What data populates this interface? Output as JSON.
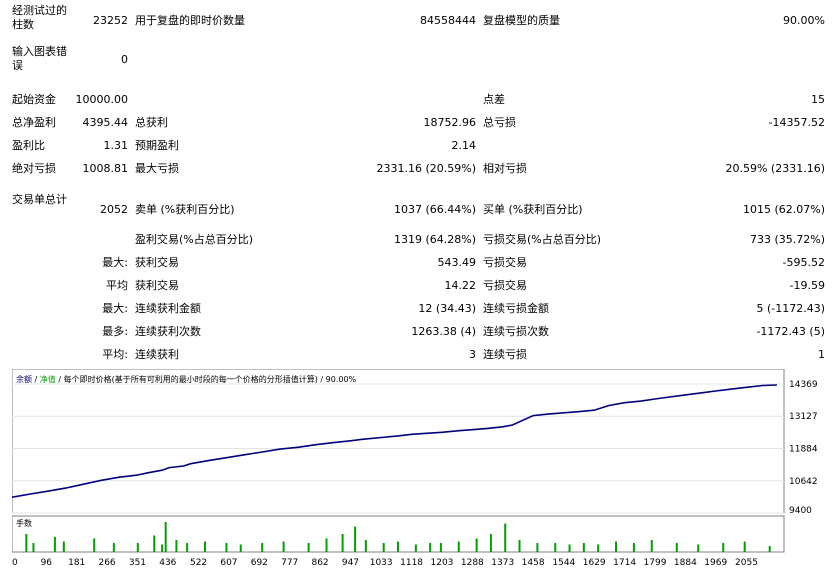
{
  "report": {
    "bars_tested_label": "经测试过的柱数",
    "bars_tested_value": "23252",
    "ticks_label": "用于复盘的即时价数量",
    "ticks_value": "84558444",
    "model_quality_label": "复盘模型的质量",
    "model_quality_value": "90.00%",
    "mismatched_errors_label": "输入图表错误",
    "mismatched_errors_value": "0",
    "initial_deposit_label": "起始资金",
    "initial_deposit_value": "10000.00",
    "spread_label": "点差",
    "spread_value": "15",
    "net_profit_label": "总净盈利",
    "net_profit_value": "4395.44",
    "gross_profit_label": "总获利",
    "gross_profit_value": "18752.96",
    "gross_loss_label": "总亏损",
    "gross_loss_value": "-14357.52",
    "profit_factor_label": "盈利比",
    "profit_factor_value": "1.31",
    "expected_payoff_label": "预期盈利",
    "expected_payoff_value": "2.14",
    "abs_drawdown_label": "绝对亏损",
    "abs_drawdown_value": "1008.81",
    "max_drawdown_label": "最大亏损",
    "max_drawdown_value": "2331.16 (20.59%)",
    "rel_drawdown_label": "相对亏损",
    "rel_drawdown_value": "20.59% (2331.16)",
    "total_trades_label": "交易单总计",
    "total_trades_value": "2052",
    "short_label": "卖单 (%获利百分比)",
    "short_value": "1037 (66.44%)",
    "long_label": "买单 (%获利百分比)",
    "long_value": "1015 (62.07%)",
    "profit_trades_label": "盈利交易(%占总百分比)",
    "profit_trades_value": "1319 (64.28%)",
    "loss_trades_label": "亏损交易(%占总百分比)",
    "loss_trades_value": "733 (35.72%)",
    "largest_label": "最大:",
    "largest_profit_label": "获利交易",
    "largest_profit_value": "543.49",
    "largest_loss_label": "亏损交易",
    "largest_loss_value": "-595.52",
    "average_label": "平均",
    "average_profit_label": "获利交易",
    "average_profit_value": "14.22",
    "average_loss_label": "亏损交易",
    "average_loss_value": "-19.59",
    "maximum_label": "最大:",
    "max_consec_wins_label": "连续获利金额",
    "max_consec_wins_value": "12 (34.43)",
    "max_consec_losses_label": "连续亏损金额",
    "max_consec_losses_value": "5 (-1172.43)",
    "maximal_label": "最多:",
    "maximal_consec_profit_label": "连续获利次数",
    "maximal_consec_profit_value": "1263.38 (4)",
    "maximal_consec_loss_label": "连续亏损次数",
    "maximal_consec_loss_value": "-1172.43 (5)",
    "avg_consec_label": "平均:",
    "avg_consec_wins_label": "连续获利",
    "avg_consec_wins_value": "3",
    "avg_consec_losses_label": "连续亏损",
    "avg_consec_losses_value": "1"
  },
  "chart_data": {
    "type": "line",
    "legend": {
      "balance": "余额",
      "equity": "净值",
      "caption": "每个即时价格(基于所有可利用的最小时段的每一个价格的分形插值计算)",
      "quality": "90.00%"
    },
    "volume_label": "手数",
    "x_ticks": [
      0,
      96,
      181,
      266,
      351,
      436,
      522,
      607,
      692,
      777,
      862,
      947,
      1033,
      1118,
      1203,
      1288,
      1373,
      1458,
      1544,
      1629,
      1714,
      1799,
      1884,
      1969,
      2055
    ],
    "y_ticks": [
      14369,
      13127,
      11884,
      10642,
      9400
    ],
    "ylim": [
      9400,
      14369
    ],
    "xlim": [
      0,
      2160
    ],
    "series": [
      {
        "color": "#00007f",
        "x": [
          0,
          60,
          100,
          150,
          200,
          250,
          300,
          350,
          380,
          420,
          440,
          480,
          500,
          550,
          600,
          650,
          700,
          750,
          800,
          850,
          900,
          947,
          980,
          1033,
          1080,
          1118,
          1160,
          1203,
          1250,
          1288,
          1330,
          1373,
          1400,
          1458,
          1500,
          1544,
          1580,
          1629,
          1670,
          1714,
          1760,
          1799,
          1840,
          1884,
          1930,
          1969,
          2010,
          2055,
          2100,
          2140
        ],
        "y": [
          10010,
          10150,
          10240,
          10360,
          10510,
          10660,
          10780,
          10860,
          10950,
          11050,
          11150,
          11210,
          11300,
          11420,
          11530,
          11640,
          11750,
          11860,
          11930,
          12030,
          12110,
          12180,
          12240,
          12310,
          12370,
          12430,
          12470,
          12510,
          12570,
          12610,
          12660,
          12720,
          12790,
          13150,
          13210,
          13260,
          13300,
          13360,
          13540,
          13650,
          13710,
          13790,
          13870,
          13950,
          14030,
          14100,
          14170,
          14240,
          14310,
          14330
        ]
      }
    ],
    "volume": [
      {
        "x": 40,
        "v": 0.6
      },
      {
        "x": 60,
        "v": 0.3
      },
      {
        "x": 120,
        "v": 0.5
      },
      {
        "x": 145,
        "v": 0.35
      },
      {
        "x": 230,
        "v": 0.45
      },
      {
        "x": 285,
        "v": 0.3
      },
      {
        "x": 352,
        "v": 0.3
      },
      {
        "x": 398,
        "v": 0.55
      },
      {
        "x": 420,
        "v": 0.25
      },
      {
        "x": 430,
        "v": 1.0
      },
      {
        "x": 460,
        "v": 0.4
      },
      {
        "x": 490,
        "v": 0.3
      },
      {
        "x": 540,
        "v": 0.35
      },
      {
        "x": 600,
        "v": 0.3
      },
      {
        "x": 640,
        "v": 0.25
      },
      {
        "x": 700,
        "v": 0.3
      },
      {
        "x": 760,
        "v": 0.35
      },
      {
        "x": 830,
        "v": 0.3
      },
      {
        "x": 880,
        "v": 0.45
      },
      {
        "x": 925,
        "v": 0.6
      },
      {
        "x": 960,
        "v": 0.85
      },
      {
        "x": 990,
        "v": 0.4
      },
      {
        "x": 1040,
        "v": 0.3
      },
      {
        "x": 1080,
        "v": 0.35
      },
      {
        "x": 1130,
        "v": 0.25
      },
      {
        "x": 1170,
        "v": 0.3
      },
      {
        "x": 1200,
        "v": 0.3
      },
      {
        "x": 1250,
        "v": 0.35
      },
      {
        "x": 1300,
        "v": 0.45
      },
      {
        "x": 1340,
        "v": 0.6
      },
      {
        "x": 1380,
        "v": 0.95
      },
      {
        "x": 1420,
        "v": 0.4
      },
      {
        "x": 1470,
        "v": 0.3
      },
      {
        "x": 1520,
        "v": 0.3
      },
      {
        "x": 1560,
        "v": 0.25
      },
      {
        "x": 1600,
        "v": 0.3
      },
      {
        "x": 1640,
        "v": 0.25
      },
      {
        "x": 1690,
        "v": 0.35
      },
      {
        "x": 1740,
        "v": 0.3
      },
      {
        "x": 1790,
        "v": 0.4
      },
      {
        "x": 1860,
        "v": 0.3
      },
      {
        "x": 1920,
        "v": 0.25
      },
      {
        "x": 1990,
        "v": 0.3
      },
      {
        "x": 2050,
        "v": 0.35
      },
      {
        "x": 2120,
        "v": 0.2
      }
    ]
  }
}
